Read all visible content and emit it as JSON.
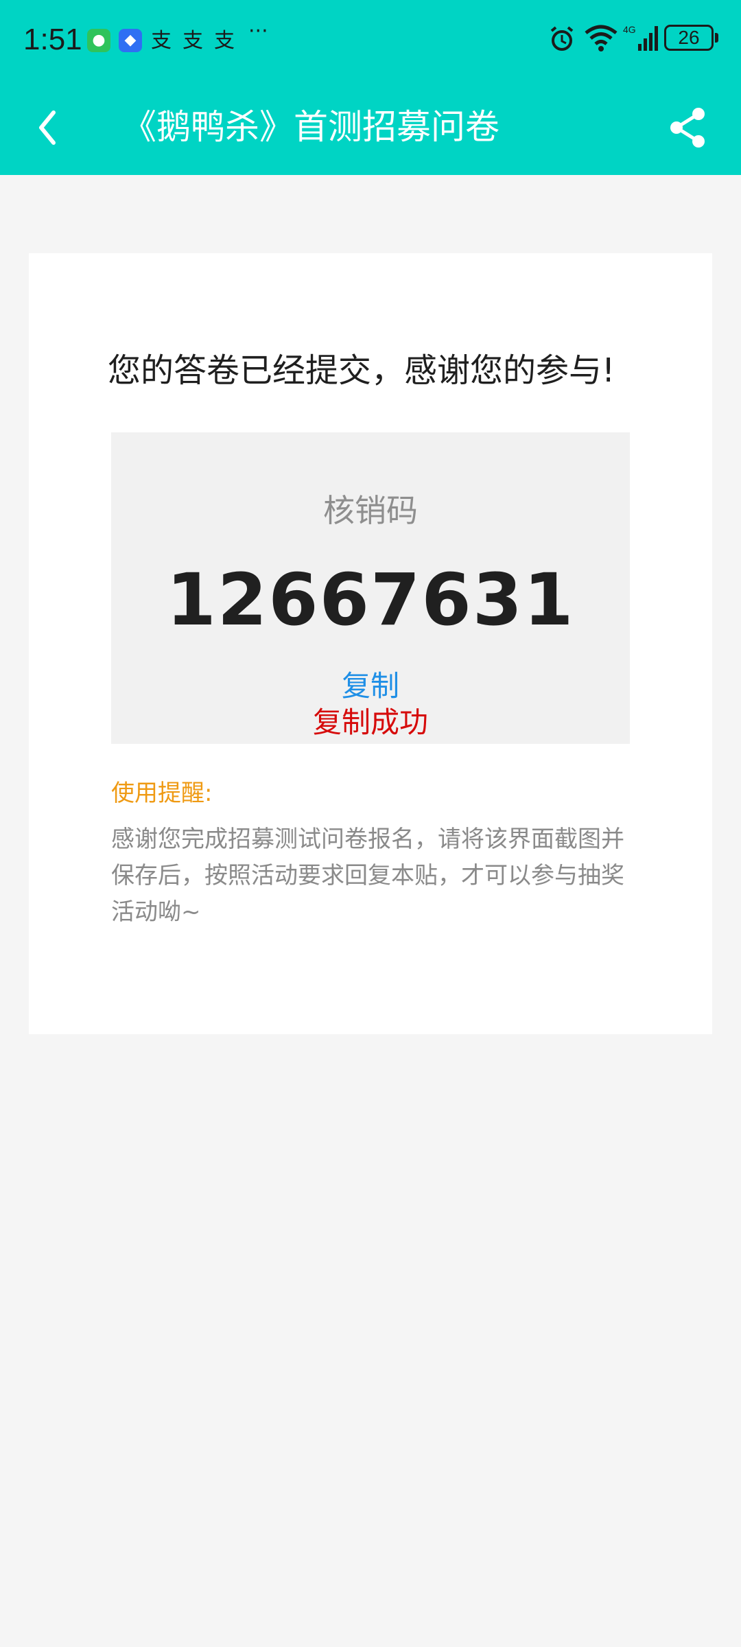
{
  "status_bar": {
    "time": "1:51",
    "icons": [
      "wechat-icon",
      "blue-app-icon",
      "alipay-icon",
      "alipay-icon",
      "alipay-icon",
      "more-icon",
      "alarm-icon",
      "wifi-icon",
      "signal-4g-icon",
      "battery-icon"
    ],
    "alipay_glyph": "支",
    "ellipsis": "···",
    "signal_label": "4G",
    "battery_level": "26",
    "bar_color": "#00d4c4"
  },
  "app_bar": {
    "title": "《鹅鸭杀》首测招募问卷",
    "back_icon": "chevron-left-icon",
    "share_icon": "share-icon"
  },
  "card": {
    "message": "您的答卷已经提交，感谢您的参与!",
    "code_label": "核销码",
    "code_value": "12667631",
    "copy_label": "复制",
    "copy_success": "复制成功",
    "tip_title": "使用提醒:",
    "tip_body": "感谢您完成招募测试问卷报名，请将该界面截图并保存后，按照活动要求回复本贴，才可以参与抽奖活动呦~"
  },
  "colors": {
    "accent": "#00d4c4",
    "copy_link": "#1f8fe6",
    "success": "#d60b0b",
    "tip_title": "#ef9a13"
  }
}
